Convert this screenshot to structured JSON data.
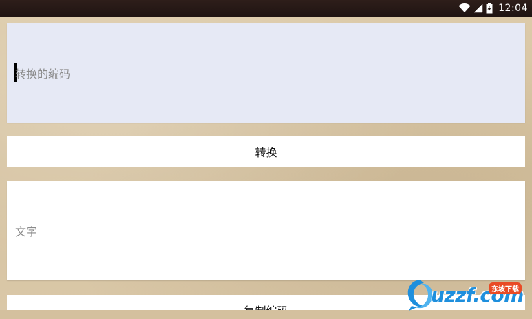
{
  "status_bar": {
    "time": "12:04",
    "icons": [
      "wifi-icon",
      "cell-signal-icon",
      "battery-charging-icon"
    ]
  },
  "input_code": {
    "placeholder": "转换的编码",
    "value": ""
  },
  "convert_button": {
    "label": "转换"
  },
  "input_text": {
    "placeholder": "文字",
    "value": ""
  },
  "copy_button": {
    "label": "复制编码"
  },
  "watermark": {
    "text": "uzzf.com",
    "badge": "东坡下载",
    "color": "#1e8fdd",
    "badge_color": "#e94b26"
  },
  "colors": {
    "status_bar": "#231715",
    "input_focused_bg": "#e6e9f5",
    "background": "#d8c6a6"
  }
}
